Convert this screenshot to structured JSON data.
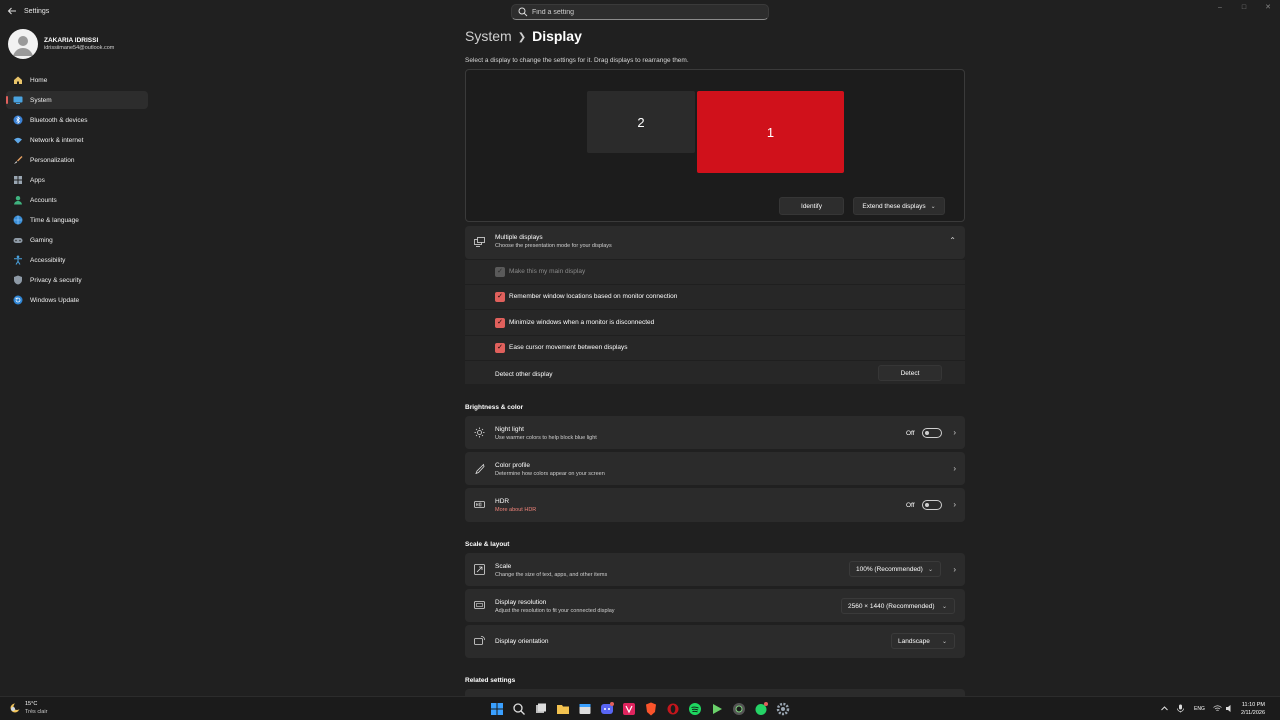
{
  "window": {
    "title": "Settings",
    "back_icon": "back-arrow-icon",
    "search_placeholder": "Find a setting",
    "controls": [
      "minimize",
      "maximize",
      "close"
    ]
  },
  "user": {
    "name": "ZAKARIA IDRISSI",
    "email": "idrissiimane54@outlook.com"
  },
  "sidebar": {
    "items": [
      {
        "label": "Home",
        "icon": "home-icon",
        "active": false
      },
      {
        "label": "System",
        "icon": "system-icon",
        "active": true
      },
      {
        "label": "Bluetooth & devices",
        "icon": "bluetooth-icon",
        "active": false
      },
      {
        "label": "Network & internet",
        "icon": "wifi-icon",
        "active": false
      },
      {
        "label": "Personalization",
        "icon": "brush-icon",
        "active": false
      },
      {
        "label": "Apps",
        "icon": "apps-icon",
        "active": false
      },
      {
        "label": "Accounts",
        "icon": "accounts-icon",
        "active": false
      },
      {
        "label": "Time & language",
        "icon": "globe-icon",
        "active": false
      },
      {
        "label": "Gaming",
        "icon": "gamepad-icon",
        "active": false
      },
      {
        "label": "Accessibility",
        "icon": "accessibility-icon",
        "active": false
      },
      {
        "label": "Privacy & security",
        "icon": "shield-icon",
        "active": false
      },
      {
        "label": "Windows Update",
        "icon": "update-icon",
        "active": false
      }
    ]
  },
  "page": {
    "breadcrumb_parent": "System",
    "breadcrumb_current": "Display",
    "subtitle": "Select a display to change the settings for it. Drag displays to rearrange them."
  },
  "arrangement": {
    "monitor_1": "1",
    "monitor_2": "2",
    "identify_label": "Identify",
    "extend_label": "Extend these displays",
    "accent_color": "#d0111b"
  },
  "multiple_displays": {
    "title": "Multiple displays",
    "desc": "Choose the presentation mode for your displays",
    "options": [
      {
        "label": "Make this my main display",
        "checked": true,
        "disabled": true
      },
      {
        "label": "Remember window locations based on monitor connection",
        "checked": true,
        "disabled": false
      },
      {
        "label": "Minimize windows when a monitor is disconnected",
        "checked": true,
        "disabled": false
      },
      {
        "label": "Ease cursor movement between displays",
        "checked": true,
        "disabled": false
      }
    ],
    "detect_label": "Detect other display",
    "detect_button": "Detect"
  },
  "brightness": {
    "heading": "Brightness & color",
    "night_light": {
      "title": "Night light",
      "desc": "Use warmer colors to help block blue light",
      "state": "Off"
    },
    "color_profile": {
      "title": "Color profile",
      "desc": "Determine how colors appear on your screen"
    },
    "hdr": {
      "title": "HDR",
      "link": "More about HDR",
      "state": "Off"
    }
  },
  "scale_layout": {
    "heading": "Scale & layout",
    "scale": {
      "title": "Scale",
      "desc": "Change the size of text, apps, and other items",
      "value": "100% (Recommended)"
    },
    "resolution": {
      "title": "Display resolution",
      "desc": "Adjust the resolution to fit your connected display",
      "value": "2560 × 1440 (Recommended)"
    },
    "orientation": {
      "title": "Display orientation",
      "value": "Landscape"
    }
  },
  "related": {
    "heading": "Related settings"
  },
  "taskbar": {
    "weather_temp": "15°C",
    "weather_desc": "Très clair",
    "language": "ENG",
    "time": "11:10 PM",
    "date": "2/11/2026",
    "apps": [
      "windows-start-icon",
      "search-icon",
      "task-view-icon",
      "file-explorer-icon",
      "calendar-icon",
      "discord-icon",
      "app-icon",
      "brave-icon",
      "opera-icon",
      "spotify-icon",
      "media-player-icon",
      "browser-icon",
      "whatsapp-icon",
      "settings-icon"
    ]
  },
  "colors": {
    "accent": "#e0605c",
    "background": "#202020",
    "card": "#2b2b2b"
  }
}
